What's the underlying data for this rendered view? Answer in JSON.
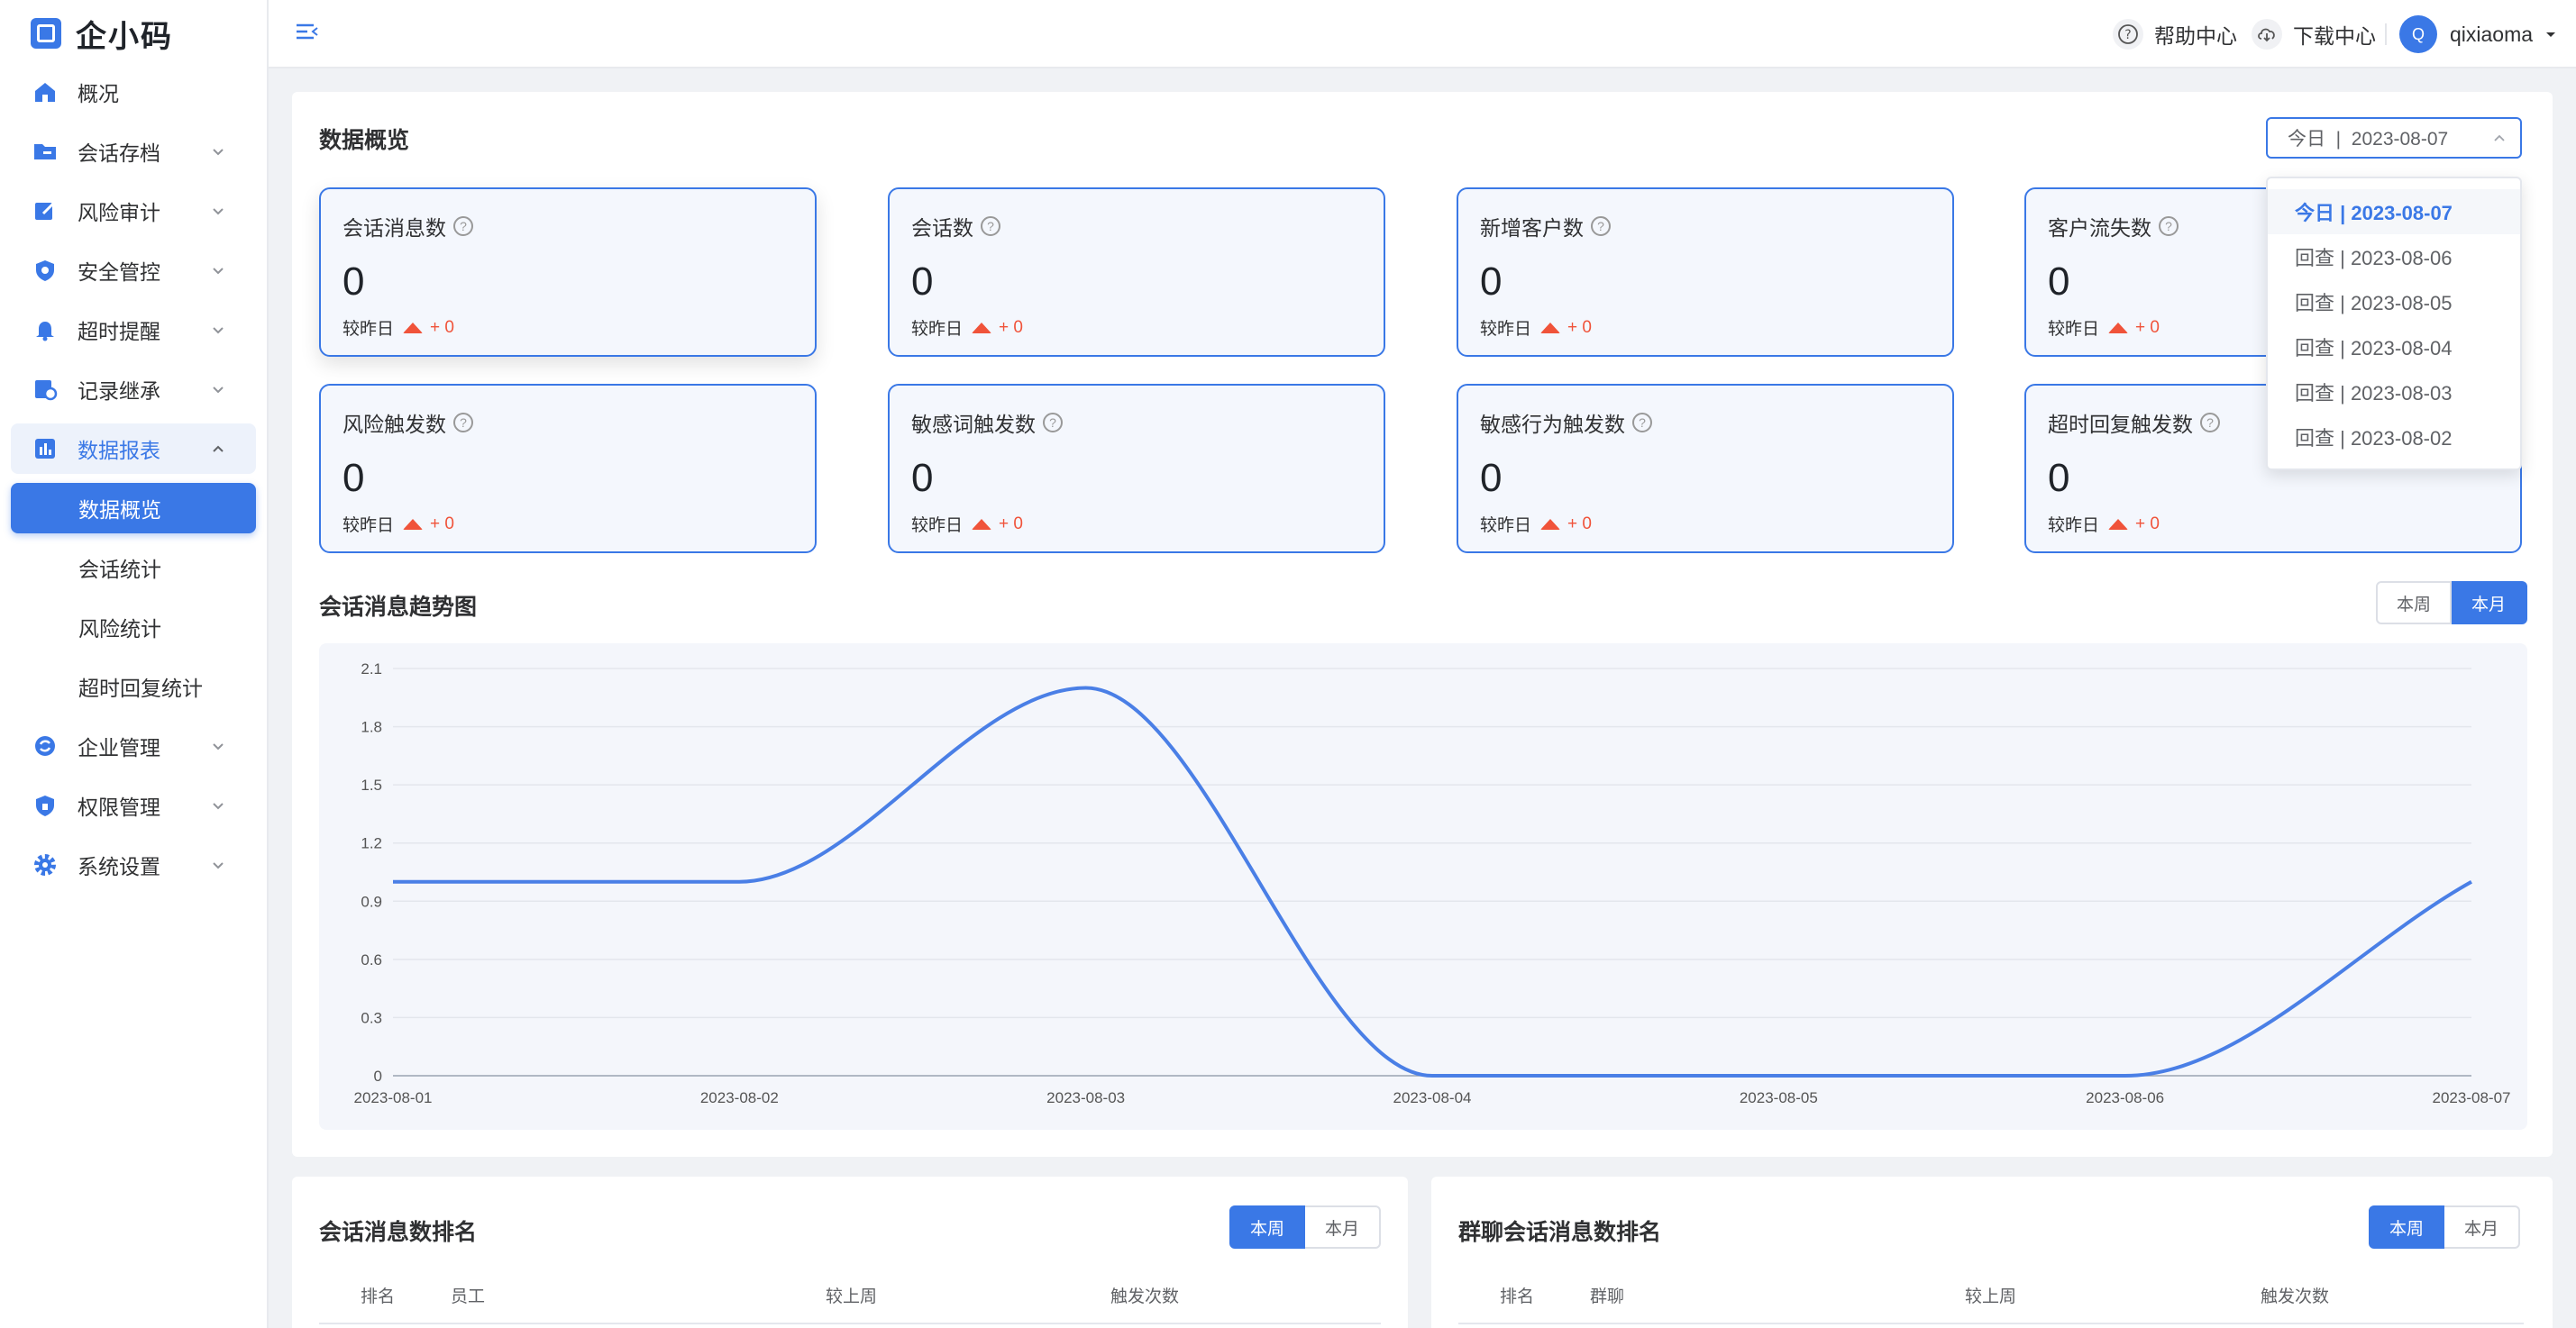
{
  "app": {
    "logo_text": "企小码"
  },
  "sidebar": {
    "items": [
      {
        "label": "概况",
        "icon": "home-icon"
      },
      {
        "label": "会话存档",
        "icon": "folder-icon"
      },
      {
        "label": "风险审计",
        "icon": "edit-icon"
      },
      {
        "label": "安全管控",
        "icon": "shield-icon"
      },
      {
        "label": "超时提醒",
        "icon": "bell-icon"
      },
      {
        "label": "记录继承",
        "icon": "transfer-icon"
      },
      {
        "label": "数据报表",
        "icon": "chart-icon"
      },
      {
        "label": "企业管理",
        "icon": "refresh-icon"
      },
      {
        "label": "权限管理",
        "icon": "lock-shield-icon"
      },
      {
        "label": "系统设置",
        "icon": "gear-icon"
      }
    ],
    "subitems": [
      "数据概览",
      "会话统计",
      "风险统计",
      "超时回复统计"
    ]
  },
  "header": {
    "help_label": "帮助中心",
    "download_label": "下载中心",
    "avatar_initial": "Q",
    "username": "qixiaoma"
  },
  "overview": {
    "title": "数据概览",
    "date_select": {
      "value": "今日  |  2023-08-07"
    },
    "date_options": [
      "今日 | 2023-08-07",
      "回查 | 2023-08-06",
      "回查 | 2023-08-05",
      "回查 | 2023-08-04",
      "回查 | 2023-08-03",
      "回查 | 2023-08-02"
    ],
    "compare_label": "较昨日",
    "stats": [
      {
        "title": "会话消息数",
        "value": "0",
        "delta": "+ 0"
      },
      {
        "title": "会话数",
        "value": "0",
        "delta": "+ 0"
      },
      {
        "title": "新增客户数",
        "value": "0",
        "delta": "+ 0"
      },
      {
        "title": "客户流失数",
        "value": "0",
        "delta": "+ 0"
      },
      {
        "title": "风险触发数",
        "value": "0",
        "delta": "+ 0"
      },
      {
        "title": "敏感词触发数",
        "value": "0",
        "delta": "+ 0"
      },
      {
        "title": "敏感行为触发数",
        "value": "0",
        "delta": "+ 0"
      },
      {
        "title": "超时回复触发数",
        "value": "0",
        "delta": "+ 0"
      }
    ]
  },
  "trend": {
    "title": "会话消息趋势图",
    "toggle": [
      "本周",
      "本月"
    ],
    "active_toggle": "本月"
  },
  "chart_data": {
    "type": "line",
    "title": "",
    "x": [
      "2023-08-01",
      "2023-08-02",
      "2023-08-03",
      "2023-08-04",
      "2023-08-05",
      "2023-08-06",
      "2023-08-07"
    ],
    "series": [
      {
        "values": [
          1,
          1,
          2,
          0,
          0,
          0,
          1
        ]
      }
    ],
    "yticks": [
      "0",
      "0.3",
      "0.6",
      "0.9",
      "1.2",
      "1.5",
      "1.8",
      "2.1"
    ],
    "ylim": [
      0,
      2.1
    ],
    "grid": true,
    "color": "#4a7fe6"
  },
  "ranking_left": {
    "title": "会话消息数排名",
    "toggle": [
      "本周",
      "本月"
    ],
    "active_toggle": "本周",
    "columns": [
      "排名",
      "员工",
      "较上周",
      "触发次数"
    ]
  },
  "ranking_right": {
    "title": "群聊会话消息数排名",
    "toggle": [
      "本周",
      "本月"
    ],
    "active_toggle": "本周",
    "columns": [
      "排名",
      "群聊",
      "较上周",
      "触发次数"
    ]
  },
  "colors": {
    "accent": "#3a78e6",
    "danger": "#f0533a"
  }
}
